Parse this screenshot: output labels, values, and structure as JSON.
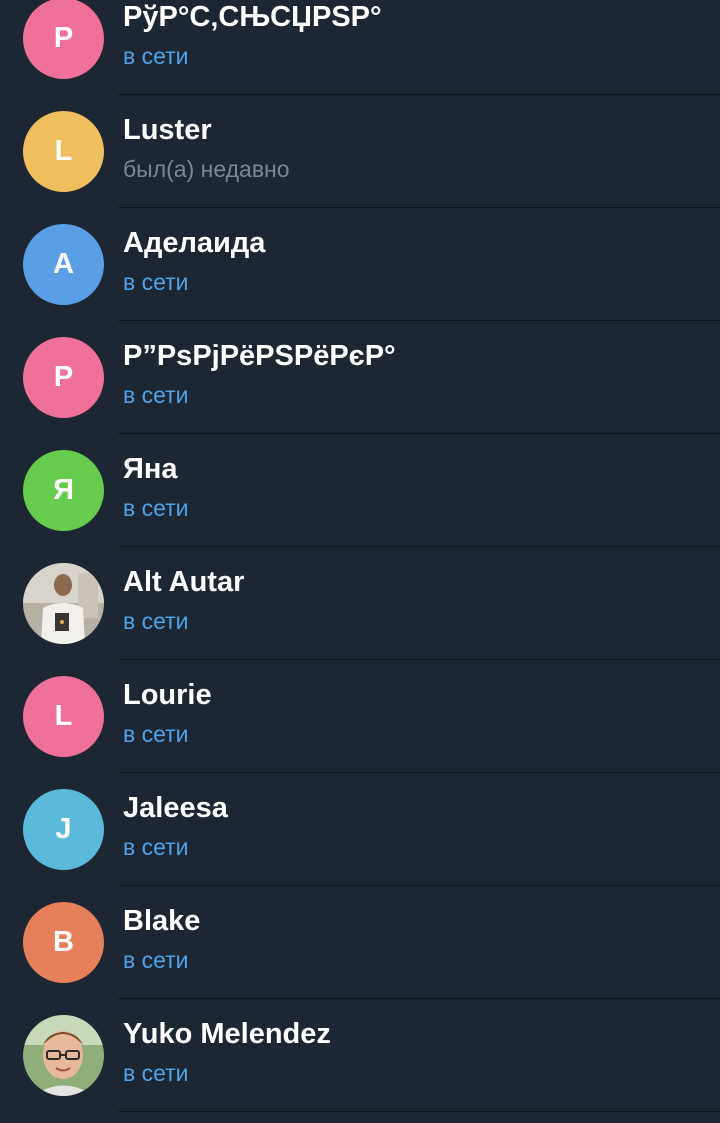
{
  "contacts": [
    {
      "name": "РўР°С‚СЊСЏРЅР°",
      "status": "в сети",
      "online": true,
      "avatar": {
        "type": "letter",
        "letter": "P",
        "color": "#ef7099"
      }
    },
    {
      "name": "Luster",
      "status": "был(а) недавно",
      "online": false,
      "avatar": {
        "type": "letter",
        "letter": "L",
        "color": "#efbe5f"
      }
    },
    {
      "name": "Аделаида",
      "status": "в сети",
      "online": true,
      "avatar": {
        "type": "letter",
        "letter": "A",
        "color": "#5a9ee6"
      }
    },
    {
      "name": "Р”РѕРјРёРЅРёРєР°",
      "status": "в сети",
      "online": true,
      "avatar": {
        "type": "letter",
        "letter": "P",
        "color": "#ef7099"
      }
    },
    {
      "name": "Яна",
      "status": "в сети",
      "online": true,
      "avatar": {
        "type": "letter",
        "letter": "Я",
        "color": "#67cc4d"
      }
    },
    {
      "name": "Alt Autar",
      "status": "в сети",
      "online": true,
      "avatar": {
        "type": "photo",
        "icon": "user-photo-icon"
      }
    },
    {
      "name": "Lourie",
      "status": "в сети",
      "online": true,
      "avatar": {
        "type": "letter",
        "letter": "L",
        "color": "#ef7099"
      }
    },
    {
      "name": "Jaleesa",
      "status": "в сети",
      "online": true,
      "avatar": {
        "type": "letter",
        "letter": "J",
        "color": "#5bbad9"
      }
    },
    {
      "name": "Blake",
      "status": "в сети",
      "online": true,
      "avatar": {
        "type": "letter",
        "letter": "B",
        "color": "#e5805b"
      }
    },
    {
      "name": "Yuko Melendez",
      "status": "в сети",
      "online": true,
      "avatar": {
        "type": "photo",
        "icon": "user-photo-icon"
      }
    }
  ]
}
